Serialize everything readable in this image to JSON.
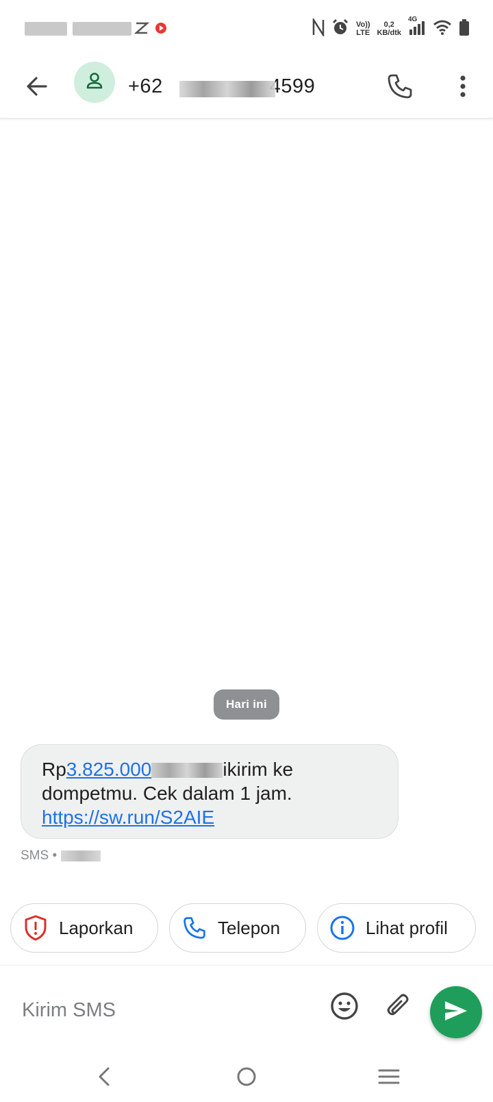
{
  "status_bar": {
    "speed_value": "0,2",
    "speed_unit": "KB/dtk",
    "volte_top": "Vo))",
    "volte_bottom": "LTE",
    "network": "4G"
  },
  "header": {
    "title": "+628          24599",
    "title_prefix": "+62",
    "title_suffix": "4599",
    "icons": [
      "back-arrow-icon",
      "person-icon",
      "phone-icon",
      "more-vert-icon"
    ]
  },
  "conversation": {
    "date_chip": "Hari ini",
    "message": {
      "prefix": "Rp",
      "amount_link": "3.825.000",
      "after_blur": "ikirim ke",
      "line2": "dompetmu. Cek dalam 1 jam.",
      "url": "https://sw.run/S2AIE"
    },
    "meta_label": "SMS •"
  },
  "suggestions": [
    {
      "label": "Laporkan",
      "icon": "report-shield-icon"
    },
    {
      "label": "Telepon",
      "icon": "phone-icon"
    },
    {
      "label": "Lihat profil",
      "icon": "info-icon"
    }
  ],
  "compose": {
    "placeholder": "Kirim SMS",
    "icons": [
      "emoji-icon",
      "attachment-icon",
      "send-icon"
    ]
  },
  "colors": {
    "accent_green": "#1e9e5a",
    "avatar_bg": "#cfeedd",
    "link_blue": "#1a73e8",
    "report_red": "#d93025",
    "chip_grey": "#8e9094"
  }
}
